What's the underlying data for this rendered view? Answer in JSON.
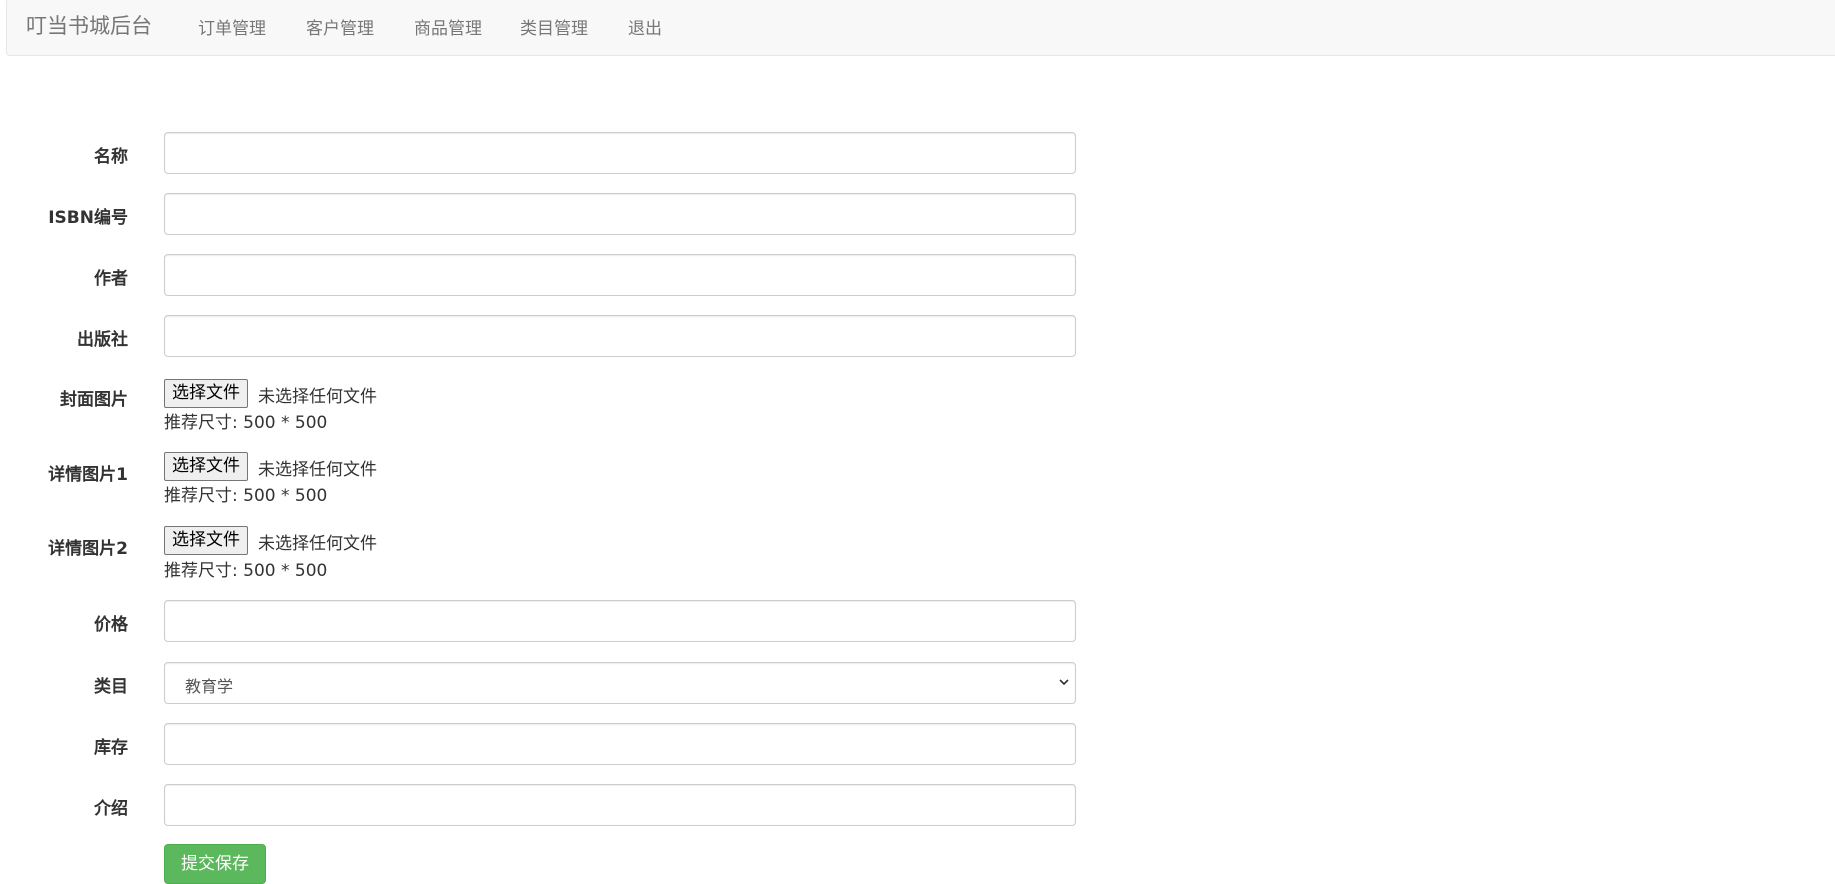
{
  "navbar": {
    "brand": "叮当书城后台",
    "items": [
      "订单管理",
      "客户管理",
      "商品管理",
      "类目管理",
      "退出"
    ]
  },
  "form": {
    "name_label": "名称",
    "isbn_label": "ISBN编号",
    "author_label": "作者",
    "publisher_label": "出版社",
    "cover_label": "封面图片",
    "detail1_label": "详情图片1",
    "detail2_label": "详情图片2",
    "price_label": "价格",
    "category_label": "类目",
    "stock_label": "库存",
    "intro_label": "介绍",
    "file_button_label": "选择文件",
    "file_status": "未选择任何文件",
    "hint": "推荐尺寸: 500 * 500",
    "category_selected": "教育学",
    "submit_label": "提交保存"
  },
  "colors": {
    "navbar_bg": "#f8f8f8",
    "submit_bg": "#5cb85c"
  }
}
